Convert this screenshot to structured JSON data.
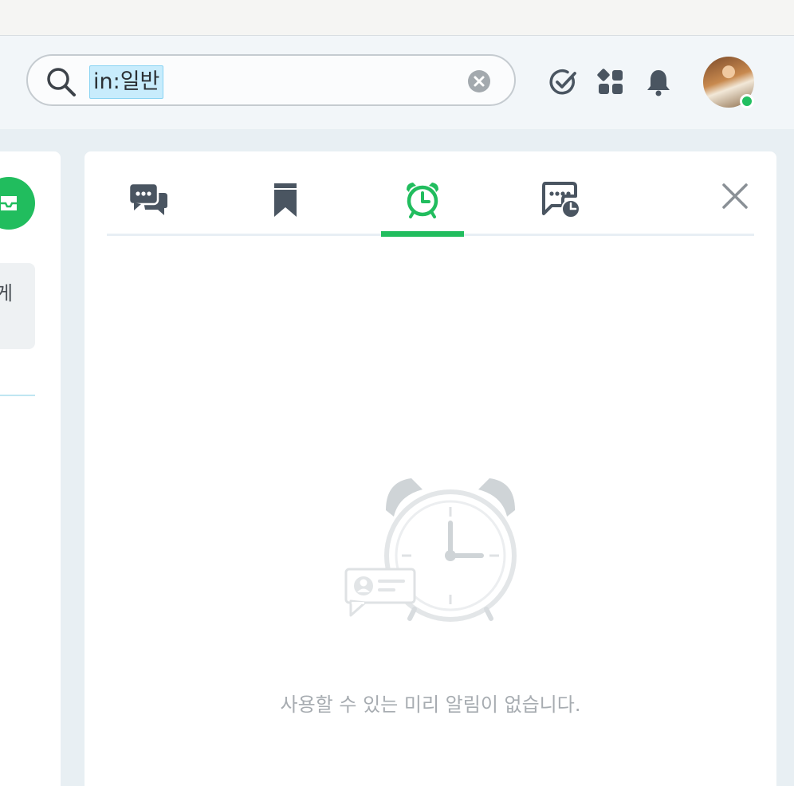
{
  "search": {
    "query": "in:일반",
    "icons": {
      "search": "search-icon",
      "clear": "clear-circle-icon"
    }
  },
  "header_actions": {
    "icons": [
      "check-circle-icon",
      "apps-grid-icon",
      "bell-icon"
    ],
    "avatar": {
      "status": "online",
      "status_color": "#22bf61"
    }
  },
  "left_panel": {
    "button_icon": "inbox-icon",
    "card_text": "게",
    "accent_color": "#21bd5e"
  },
  "main": {
    "tabs": [
      {
        "icon": "chat-bubbles-icon",
        "active": false
      },
      {
        "icon": "bookmark-icon",
        "active": false
      },
      {
        "icon": "alarm-clock-icon",
        "active": true
      },
      {
        "icon": "scheduled-message-icon",
        "active": false
      }
    ],
    "close_icon": "close-icon",
    "empty_state": {
      "illustration": "alarm-clock-illustration",
      "message": "사용할 수 있는 미리 알림이 없습니다."
    }
  },
  "colors": {
    "accent": "#21bd5e",
    "icon": "#4a5561",
    "muted_text": "#a7acb1"
  }
}
